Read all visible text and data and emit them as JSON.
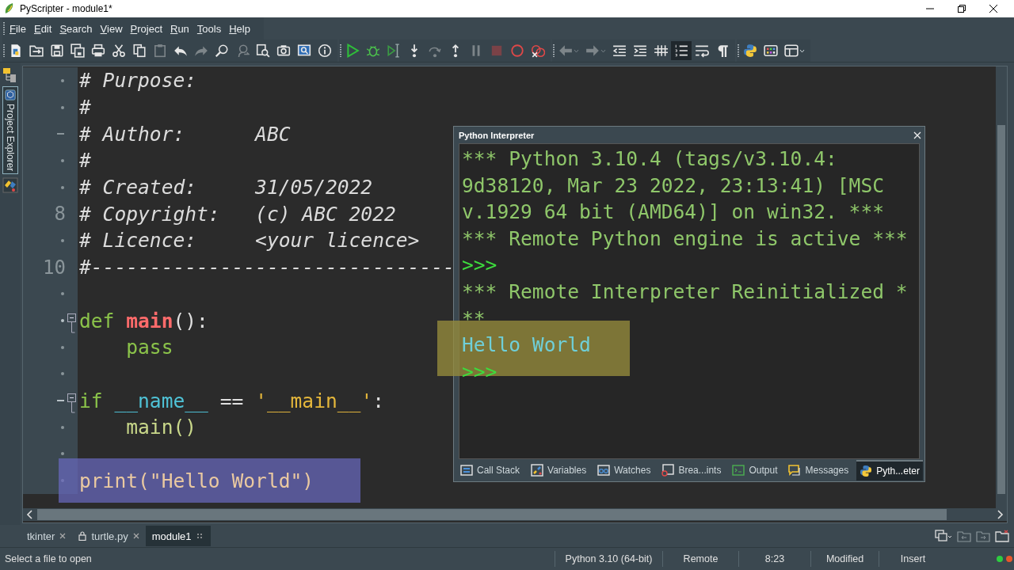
{
  "window": {
    "title": "PyScripter - module1*"
  },
  "menu": [
    "File",
    "Edit",
    "Search",
    "View",
    "Project",
    "Run",
    "Tools",
    "Help"
  ],
  "toolbar": [
    [
      {
        "kind": "new-file",
        "disabled": false,
        "on": false
      },
      {
        "kind": "open",
        "disabled": false,
        "on": false
      },
      {
        "kind": "save",
        "disabled": false,
        "on": false
      },
      {
        "kind": "save-all",
        "disabled": false,
        "on": false
      },
      {
        "kind": "print",
        "disabled": false,
        "on": false
      },
      {
        "kind": "cut",
        "disabled": false,
        "on": false
      },
      {
        "kind": "copy",
        "disabled": false,
        "on": false
      },
      {
        "kind": "paste",
        "disabled": true,
        "on": false
      },
      {
        "kind": "undo",
        "disabled": false,
        "on": false
      },
      {
        "kind": "redo",
        "disabled": true,
        "on": false
      },
      {
        "kind": "find",
        "disabled": false,
        "on": false
      },
      {
        "kind": "replace",
        "disabled": true,
        "on": false
      },
      {
        "kind": "spell",
        "disabled": false,
        "on": false
      },
      {
        "kind": "camera",
        "disabled": false,
        "on": false
      },
      {
        "kind": "monitor",
        "disabled": false,
        "on": false
      },
      {
        "kind": "info",
        "disabled": false,
        "on": false
      }
    ],
    [
      {
        "kind": "run",
        "disabled": false,
        "on": false
      },
      {
        "kind": "debug",
        "disabled": false,
        "on": false
      },
      {
        "kind": "run-cursor",
        "disabled": false,
        "on": false
      },
      {
        "kind": "step-into",
        "disabled": false,
        "on": false
      },
      {
        "kind": "step-over",
        "disabled": true,
        "on": false
      },
      {
        "kind": "step-out",
        "disabled": false,
        "on": false
      },
      {
        "kind": "pause",
        "disabled": true,
        "on": false
      },
      {
        "kind": "stop",
        "disabled": true,
        "on": false
      },
      {
        "kind": "breakpoint",
        "disabled": false,
        "on": false
      },
      {
        "kind": "clear-breakpoints",
        "disabled": false,
        "on": false
      }
    ],
    [
      {
        "kind": "back",
        "disabled": true,
        "on": false
      },
      {
        "kind": "forward",
        "disabled": true,
        "on": false
      },
      {
        "kind": "dedent",
        "disabled": false,
        "on": false
      },
      {
        "kind": "indent",
        "disabled": false,
        "on": false
      },
      {
        "kind": "grid",
        "disabled": false,
        "on": false
      },
      {
        "kind": "line-numbers",
        "disabled": false,
        "on": true
      },
      {
        "kind": "wrap",
        "disabled": false,
        "on": false
      },
      {
        "kind": "pilcrow",
        "disabled": false,
        "on": false
      }
    ],
    [
      {
        "kind": "python",
        "disabled": false,
        "on": false
      },
      {
        "kind": "palette",
        "disabled": false,
        "on": false
      },
      {
        "kind": "layout",
        "disabled": false,
        "on": false
      }
    ]
  ],
  "side_panel": {
    "tabs": [
      {
        "label": "Project Explorer",
        "selected": true
      }
    ]
  },
  "editor": {
    "lines": [
      {
        "kind": "dot",
        "fold": false,
        "highlighted": false,
        "tokens": [
          {
            "kind": "comment",
            "text": "# Purpose:"
          }
        ]
      },
      {
        "kind": "dot",
        "fold": false,
        "highlighted": false,
        "tokens": [
          {
            "kind": "comment",
            "text": "#"
          }
        ]
      },
      {
        "kind": "dash",
        "fold": false,
        "highlighted": false,
        "tokens": [
          {
            "kind": "comment",
            "text": "# Author:      ABC"
          }
        ]
      },
      {
        "kind": "dot",
        "fold": false,
        "highlighted": false,
        "tokens": [
          {
            "kind": "comment",
            "text": "#"
          }
        ]
      },
      {
        "kind": "dot",
        "fold": false,
        "highlighted": false,
        "tokens": [
          {
            "kind": "comment",
            "text": "# Created:     31/05/2022"
          }
        ]
      },
      {
        "kind": "number",
        "number": "8",
        "fold": false,
        "highlighted": false,
        "tokens": [
          {
            "kind": "comment",
            "text": "# Copyright:   (c) ABC 2022"
          }
        ]
      },
      {
        "kind": "dot",
        "fold": false,
        "highlighted": false,
        "tokens": [
          {
            "kind": "comment",
            "text": "# Licence:     <your licence>"
          }
        ]
      },
      {
        "kind": "number",
        "number": "10",
        "fold": false,
        "highlighted": false,
        "tokens": [
          {
            "kind": "comment",
            "text": "#-------------------------------"
          }
        ]
      },
      {
        "kind": "dot",
        "fold": false,
        "highlighted": false
      },
      {
        "kind": "dot",
        "fold": true,
        "highlighted": false,
        "tokens": [
          {
            "kind": "keyword",
            "text": "def "
          },
          {
            "kind": "funcname",
            "text": "main"
          },
          {
            "kind": "plain",
            "text": "():"
          }
        ]
      },
      {
        "kind": "dot",
        "fold": false,
        "highlighted": false,
        "tokens": [
          {
            "kind": "keyword",
            "text": "    pass"
          }
        ]
      },
      {
        "kind": "dot",
        "fold": false,
        "highlighted": false
      },
      {
        "kind": "dash",
        "fold": true,
        "highlighted": false,
        "tokens": [
          {
            "kind": "keyword",
            "text": "if "
          },
          {
            "kind": "dunder",
            "text": "__name__"
          },
          {
            "kind": "plain",
            "text": " == "
          },
          {
            "kind": "string",
            "text": "'__main__'"
          },
          {
            "kind": "plain",
            "text": ":"
          }
        ]
      },
      {
        "kind": "dot",
        "fold": false,
        "highlighted": false,
        "tokens": [
          {
            "kind": "call",
            "text": "    main()"
          }
        ]
      },
      {
        "kind": "dot",
        "fold": false,
        "highlighted": false
      },
      {
        "kind": "dot",
        "fold": false,
        "highlighted": true,
        "tokens": [
          {
            "kind": "builtin",
            "text": "print(\"Hello World\")"
          }
        ]
      }
    ]
  },
  "interpreter": {
    "title": "Python Interpreter",
    "lines": [
      {
        "kind": "output",
        "text": "*** Python 3.10.4 (tags/v3.10.4:",
        "highlighted": false
      },
      {
        "kind": "output",
        "text": "9d38120, Mar 23 2022, 23:13:41) [MSC",
        "highlighted": false
      },
      {
        "kind": "output",
        "text": "v.1929 64 bit (AMD64)] on win32. ***",
        "highlighted": false
      },
      {
        "kind": "output",
        "text": "*** Remote Python engine is active ***",
        "highlighted": false
      },
      {
        "kind": "prompt",
        "text": ">>>",
        "highlighted": false
      },
      {
        "kind": "output",
        "text": "*** Remote Interpreter Reinitialized *",
        "highlighted": false
      },
      {
        "kind": "output",
        "text": "**",
        "highlighted": false
      },
      {
        "kind": "result",
        "text": "Hello World",
        "highlighted": true
      },
      {
        "kind": "prompt",
        "text": ">>>",
        "highlighted": false
      }
    ],
    "tabs": [
      {
        "kind": "call-stack",
        "label": "Call Stack",
        "selected": false
      },
      {
        "kind": "variables",
        "label": "Variables",
        "selected": false
      },
      {
        "kind": "watches",
        "label": "Watches",
        "selected": false
      },
      {
        "kind": "breakpoints",
        "label": "Brea...ints",
        "selected": false
      },
      {
        "kind": "output",
        "label": "Output",
        "selected": false
      },
      {
        "kind": "messages",
        "label": "Messages",
        "selected": false
      },
      {
        "kind": "interpreter",
        "label": "Pyth...eter",
        "selected": true
      }
    ]
  },
  "document_tabs": [
    {
      "label": "tkinter",
      "locked": false,
      "selected": false
    },
    {
      "label": "turtle.py",
      "locked": true,
      "selected": false
    },
    {
      "label": "module1",
      "locked": false,
      "selected": true
    }
  ],
  "status_bar": {
    "message": "Select a file to open",
    "fields": [
      "Python 3.10 (64-bit)",
      "Remote",
      "8:23",
      "Modified",
      "Insert"
    ],
    "indicators": [
      {
        "color": "#2ecc40"
      },
      {
        "color": "#e8572a"
      }
    ]
  }
}
